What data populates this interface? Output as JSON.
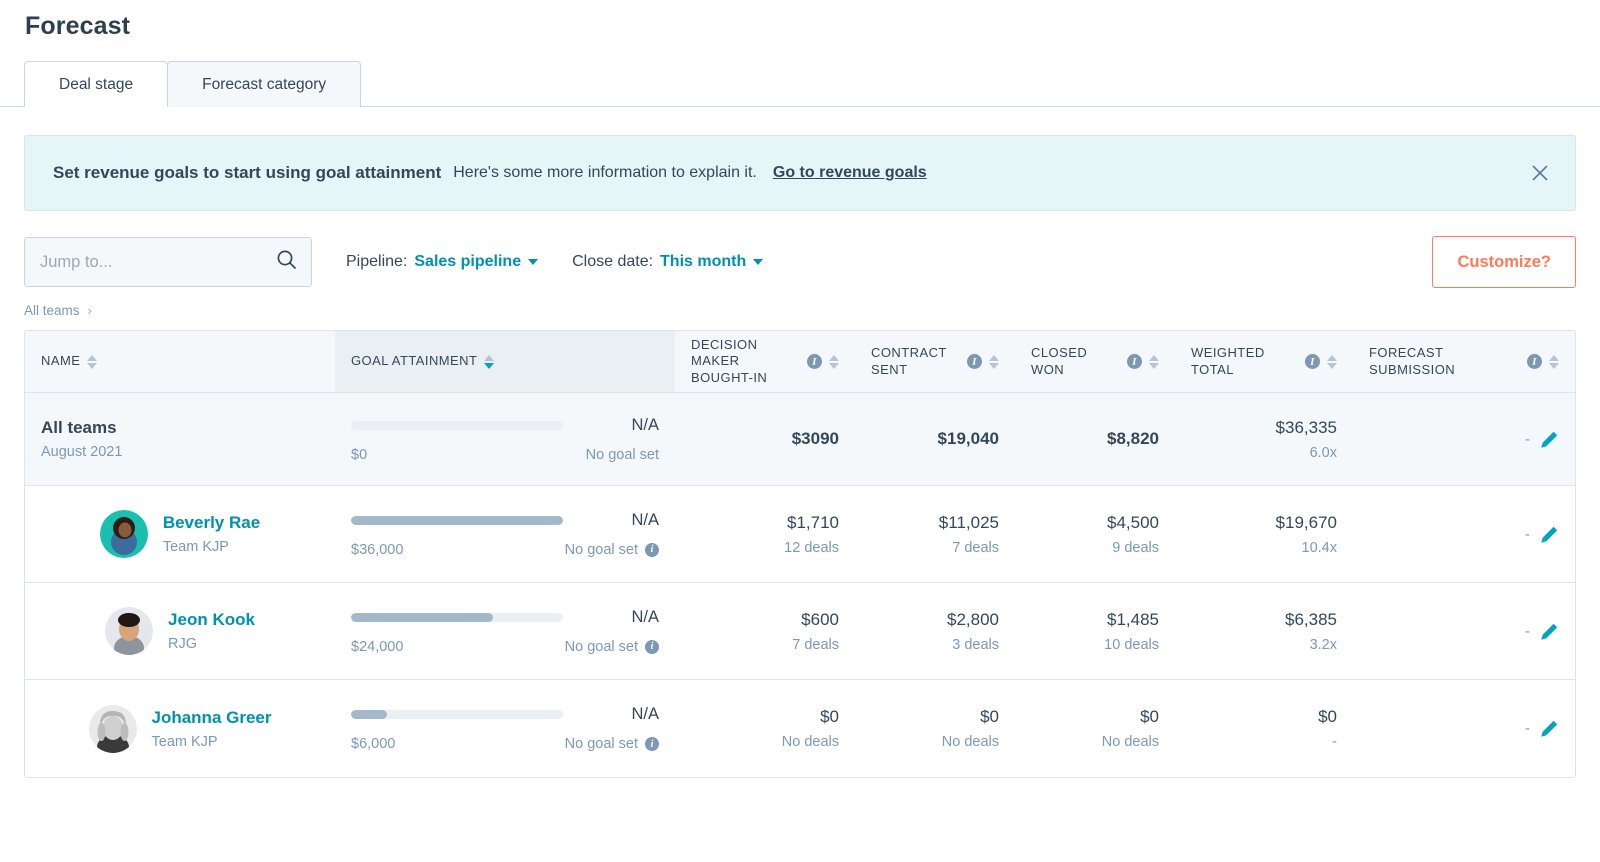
{
  "header": {
    "title": "Forecast"
  },
  "tabs": [
    {
      "label": "Deal stage",
      "active": true
    },
    {
      "label": "Forecast category",
      "active": false
    }
  ],
  "banner": {
    "headline": "Set revenue goals to start using goal attainment",
    "body": "Here's some more information to explain it.",
    "link": "Go to revenue goals",
    "close_icon": "close-icon",
    "background_color": "#e5f5f8"
  },
  "filters": {
    "search_placeholder": "Jump to...",
    "search_value": "",
    "search_icon": "search-icon",
    "pipeline_label": "Pipeline:",
    "pipeline_value": "Sales pipeline",
    "close_date_label": "Close date:",
    "close_date_value": "This month",
    "customize_label": "Customize?",
    "customize_color": "#ff7a59"
  },
  "breadcrumb": {
    "root": "All teams",
    "separator": "›"
  },
  "table": {
    "columns": [
      {
        "key": "name",
        "label": "NAME",
        "info": false,
        "sorted": false
      },
      {
        "key": "goal",
        "label": "GOAL ATTAINMENT",
        "info": false,
        "sorted": true,
        "direction": "desc"
      },
      {
        "key": "dm",
        "label": "DECISION MAKER BOUGHT-IN",
        "info": true,
        "sorted": false
      },
      {
        "key": "cs",
        "label": "CONTRACT SENT",
        "info": true,
        "sorted": false
      },
      {
        "key": "cw",
        "label": "CLOSED WON",
        "info": true,
        "sorted": false
      },
      {
        "key": "wt",
        "label": "WEIGHTED TOTAL",
        "info": true,
        "sorted": false
      },
      {
        "key": "fs",
        "label": "FORECAST SUBMISSION",
        "info": true,
        "sorted": false
      }
    ],
    "summary": {
      "name": "All teams",
      "sub": "August 2021",
      "goal_percent_label": "N/A",
      "goal_amount": "$0",
      "goal_note": "No goal set",
      "goal_fill_percent": 0,
      "decision_maker": "$3090",
      "decision_maker_sub": "",
      "contract_sent": "$19,040",
      "contract_sent_sub": "",
      "closed_won": "$8,820",
      "closed_won_sub": "",
      "weighted_total": "$36,335",
      "weighted_total_sub": "6.0x",
      "forecast_submission": "-"
    },
    "rows": [
      {
        "name": "Beverly Rae",
        "sub": "Team KJP",
        "avatar_color": "#19bfaf",
        "goal_percent_label": "N/A",
        "goal_amount": "$36,000",
        "goal_note": "No goal set",
        "goal_fill_percent": 100,
        "decision_maker": "$1,710",
        "decision_maker_sub": "12 deals",
        "contract_sent": "$11,025",
        "contract_sent_sub": "7 deals",
        "closed_won": "$4,500",
        "closed_won_sub": "9 deals",
        "weighted_total": "$19,670",
        "weighted_total_sub": "10.4x",
        "forecast_submission": "-"
      },
      {
        "name": "Jeon Kook",
        "sub": "RJG",
        "avatar_color": "#d6dfe8",
        "goal_percent_label": "N/A",
        "goal_amount": "$24,000",
        "goal_note": "No goal set",
        "goal_fill_percent": 67,
        "decision_maker": "$600",
        "decision_maker_sub": "7 deals",
        "contract_sent": "$2,800",
        "contract_sent_sub": "3 deals",
        "closed_won": "$1,485",
        "closed_won_sub": "10 deals",
        "weighted_total": "$6,385",
        "weighted_total_sub": "3.2x",
        "forecast_submission": "-"
      },
      {
        "name": "Johanna Greer",
        "sub": "Team KJP",
        "avatar_color": "#c9cdd2",
        "goal_percent_label": "N/A",
        "goal_amount": "$6,000",
        "goal_note": "No goal set",
        "goal_fill_percent": 17,
        "decision_maker": "$0",
        "decision_maker_sub": "No deals",
        "contract_sent": "$0",
        "contract_sent_sub": "No deals",
        "closed_won": "$0",
        "closed_won_sub": "No deals",
        "weighted_total": "$0",
        "weighted_total_sub": "-",
        "forecast_submission": "-"
      }
    ]
  }
}
